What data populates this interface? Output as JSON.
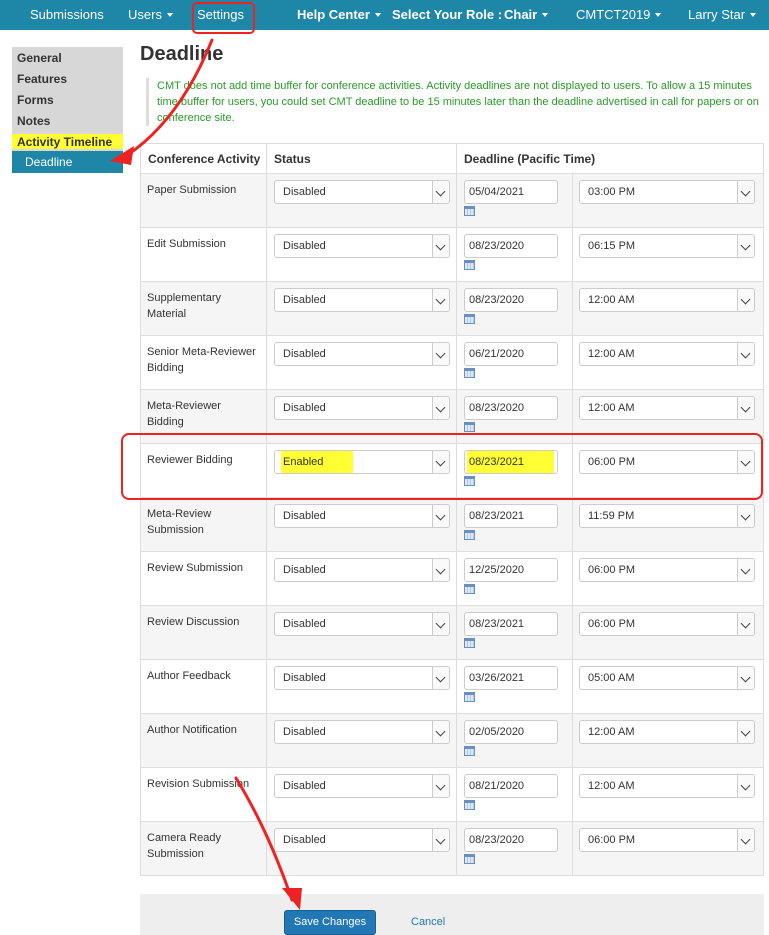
{
  "topnav": {
    "submissions": "Submissions",
    "users": "Users",
    "settings": "Settings",
    "help_center": "Help Center",
    "select_role_label": "Select Your Role :",
    "role": "Chair",
    "conference": "CMTCT2019",
    "user": "Larry Star"
  },
  "sidebar": {
    "items": [
      "General",
      "Features",
      "Forms",
      "Notes",
      "Activity Timeline"
    ],
    "active": "Deadline"
  },
  "page": {
    "title": "Deadline",
    "note": "CMT does not add time buffer for conference activities. Activity deadlines are not displayed to users. To allow a 15 minutes time buffer for users, you could set CMT deadline to be 15 minutes later than the deadline advertised in call for papers or on conference site."
  },
  "table": {
    "headers": {
      "activity": "Conference Activity",
      "status": "Status",
      "deadline": "Deadline (Pacific Time)"
    },
    "rows": [
      {
        "activity": "Paper Submission",
        "status": "Disabled",
        "date": "05/04/2021",
        "time": "03:00 PM"
      },
      {
        "activity": "Edit Submission",
        "status": "Disabled",
        "date": "08/23/2020",
        "time": "06:15 PM"
      },
      {
        "activity": "Supplementary Material",
        "status": "Disabled",
        "date": "08/23/2020",
        "time": "12:00 AM"
      },
      {
        "activity": "Senior Meta-Reviewer Bidding",
        "status": "Disabled",
        "date": "06/21/2020",
        "time": "12:00 AM"
      },
      {
        "activity": "Meta-Reviewer Bidding",
        "status": "Disabled",
        "date": "08/23/2020",
        "time": "12:00 AM"
      },
      {
        "activity": "Reviewer Bidding",
        "status": "Enabled",
        "date": "08/23/2021",
        "time": "06:00 PM"
      },
      {
        "activity": "Meta-Review Submission",
        "status": "Disabled",
        "date": "08/23/2021",
        "time": "11:59 PM"
      },
      {
        "activity": "Review Submission",
        "status": "Disabled",
        "date": "12/25/2020",
        "time": "06:00 PM"
      },
      {
        "activity": "Review Discussion",
        "status": "Disabled",
        "date": "08/23/2021",
        "time": "06:00 PM"
      },
      {
        "activity": "Author Feedback",
        "status": "Disabled",
        "date": "03/26/2021",
        "time": "05:00 AM"
      },
      {
        "activity": "Author Notification",
        "status": "Disabled",
        "date": "02/05/2020",
        "time": "12:00 AM"
      },
      {
        "activity": "Revision Submission",
        "status": "Disabled",
        "date": "08/21/2020",
        "time": "12:00 AM"
      },
      {
        "activity": "Camera Ready Submission",
        "status": "Disabled",
        "date": "08/23/2020",
        "time": "06:00 PM"
      }
    ]
  },
  "footer": {
    "save": "Save Changes",
    "cancel": "Cancel"
  },
  "colors": {
    "nav_bg": "#1e87a8",
    "highlight": "#ffff33",
    "annotation_red": "#e22222",
    "note_green": "#2a9a2a",
    "button_blue": "#2277b5"
  }
}
